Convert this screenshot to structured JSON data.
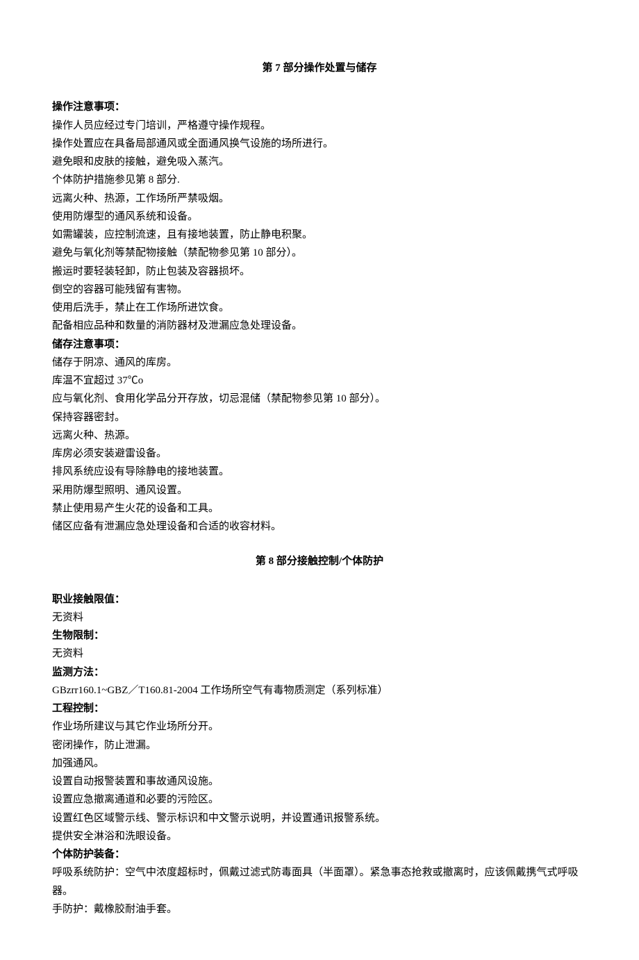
{
  "section7": {
    "title": "第 7 部分操作处置与储存",
    "operation": {
      "heading": "操作注意事项：",
      "lines": [
        "操作人员应经过专门培训，严格遵守操作规程。",
        "操作处置应在具备局部通风或全面通风换气设施的场所进行。",
        "避免眼和皮肤的接触，避免吸入蒸汽。",
        "个体防护措施参见第 8 部分.",
        "远离火种、热源，工作场所严禁吸烟。",
        "使用防爆型的通风系统和设备。",
        "如需罐装，应控制流速，且有接地装置，防止静电积聚。",
        "避免与氧化剂等禁配物接触（禁配物参见第 10 部分）。",
        "搬运时要轻装轻卸，防止包装及容器损坏。",
        "倒空的容器可能残留有害物。",
        "使用后洗手，禁止在工作场所进饮食。",
        "配备相应品种和数量的消防器材及泄漏应急处理设备。"
      ]
    },
    "storage": {
      "heading": "储存注意事项：",
      "lines": [
        "储存于阴凉、通风的库房。",
        "库温不宜超过 37℃o",
        "应与氧化剂、食用化学品分开存放，切忌混储（禁配物参见第 10 部分）。",
        "保持容器密封。",
        "远离火种、热源。",
        "库房必须安装避雷设备。",
        "排风系统应设有导除静电的接地装置。",
        "采用防爆型照明、通风设置。",
        "禁止使用易产生火花的设备和工具。",
        "储区应备有泄漏应急处理设备和合适的收容材料。"
      ]
    }
  },
  "section8": {
    "title": "第 8 部分接触控制/个体防护",
    "occupational": {
      "heading": "职业接触限值：",
      "lines": [
        "无资料"
      ]
    },
    "biological": {
      "heading": "生物限制：",
      "lines": [
        "无资料"
      ]
    },
    "monitoring": {
      "heading": "监测方法：",
      "lines": [
        "GBzrr160.1~GBZ／T160.81-2004 工作场所空气有毒物质测定（系列标准）"
      ]
    },
    "engineering": {
      "heading": "工程控制：",
      "lines": [
        "作业场所建议与其它作业场所分开。",
        "密闭操作，防止泄漏。",
        "加强通风。",
        "设置自动报警装置和事故通风设施。",
        "设置应急撤离通道和必要的污险区。",
        "设置红色区域警示线、警示标识和中文警示说明，并设置通讯报警系统。",
        "提供安全淋浴和洗眼设备。"
      ]
    },
    "ppe": {
      "heading": "个体防护装备：",
      "lines": [
        "呼吸系统防护：空气中浓度超标时，佩戴过滤式防毒面具（半面罩）。紧急事态抢救或撤离时，应该佩戴携气式呼吸器。",
        "手防护：戴橡胶耐油手套。"
      ]
    }
  }
}
